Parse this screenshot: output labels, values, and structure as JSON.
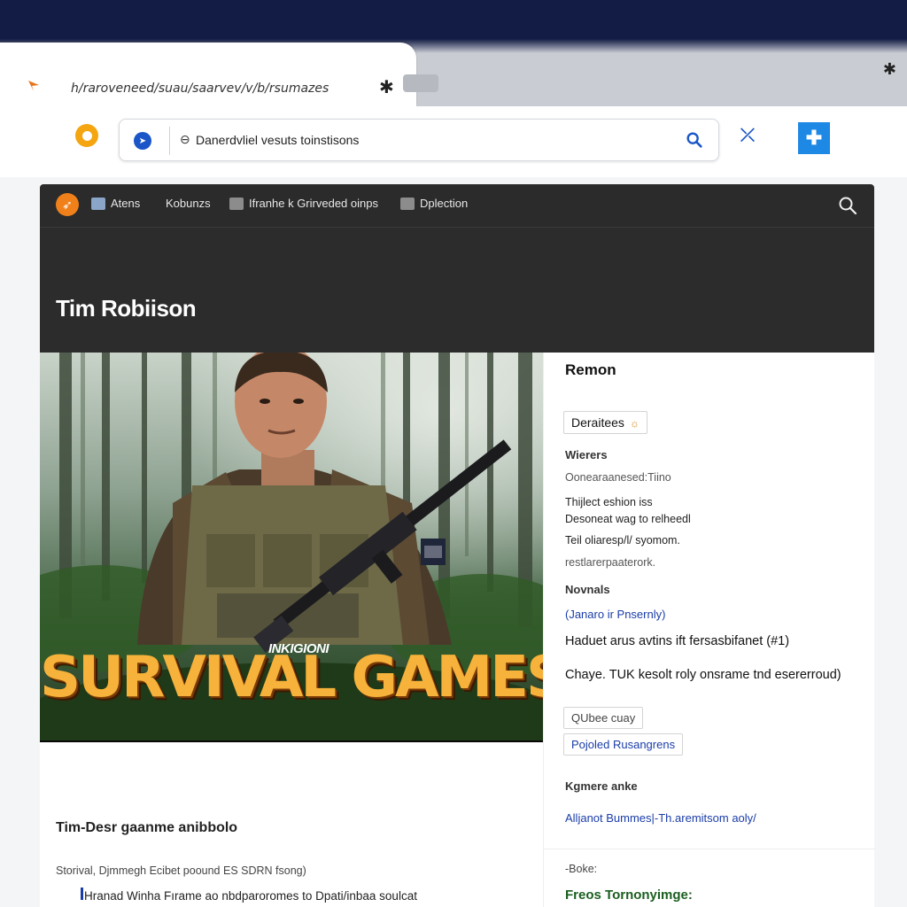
{
  "browser": {
    "tab_url": "​h/raroveneed/suau/saarvev/v/b/rsumazes",
    "tab_close_glyph": "✱",
    "address_text": "Danerdvliel vesuts toinstisons",
    "corner_left_glyph": "✦",
    "corner_right_glyph": "✱"
  },
  "site_nav": {
    "items": [
      {
        "label": "Atens"
      },
      {
        "label": "Kobunzs"
      },
      {
        "label": "Ifranhe k Grirveded oinps"
      },
      {
        "label": "Dplection"
      }
    ]
  },
  "hero": {
    "name": "Tim Robiison"
  },
  "poster": {
    "kicker": "INKIGIONI",
    "title": "SURVIVAL GAMES"
  },
  "right_panel": {
    "heading": "Remon",
    "chip_genre": "Deraitees",
    "label_writers": "Wierers",
    "writers_value": "Oonearaanesed:Tiino",
    "desc_lines": [
      "Thijlect eshion iss",
      "Desoneat wag to relheedl",
      "Teil oliaresp/l/ syomom.",
      "restlarerpaaterork."
    ],
    "label_novels": "Novnals",
    "link_publisher": "(Janaro ir Pnsernly)",
    "line_1": "Haduet arus avtins ift fersasbifanet (#1)",
    "line_2": "Chaye. TUK kesolt roly onsrame tnd esererroud)",
    "chip_query": "QUbee cuay",
    "chip_related": "Pojoled Rusangrens",
    "label_keymare": "Kgmere anke",
    "link_all": "Alljanot Bummes|-Th.aremitsom aoly/",
    "label_book": "-Boke:",
    "footer_green": "Freos Tornonyimge:"
  },
  "caption": {
    "title": "Tim-Desr gaanme anibbolo",
    "meta": "Storival, Djmmegh Ecibet poound ES SDRN fsong)",
    "line": "Hranad Winha Fırame ao nbdparoromes to Dpati/inbaa soulcat"
  },
  "colors": {
    "titlebar": "#121c44",
    "accent_blue": "#1e88e5",
    "brand_orange": "#f0811a",
    "poster_title": "#f6b23a",
    "link_blue": "#1a3da8",
    "green_text": "#1b5e20"
  }
}
